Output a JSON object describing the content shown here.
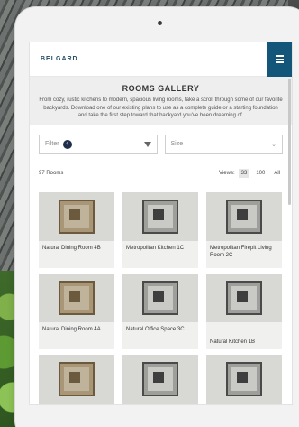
{
  "header": {
    "logo": "BELGARD"
  },
  "gallery": {
    "title": "ROOMS GALLERY",
    "description": "From cozy, rustic kitchens to modern, spacious living rooms, take a scroll through some of our favorite backyards. Download one of our existing plans to use as a complete guide or a starting foundation and take the first step toward that backyard you've been dreaming of."
  },
  "filters": {
    "filter_label": "Filter",
    "filter_count": "4",
    "size_label": "Size"
  },
  "results": {
    "count": "97 Rooms",
    "views_label": "Views:",
    "options": [
      "33",
      "100",
      "All"
    ]
  },
  "rooms": [
    {
      "label": "Natural Dining Room 4B"
    },
    {
      "label": "Metropolitan Kitchen 1C"
    },
    {
      "label": "Metropolitan Firepit Living Room 2C"
    },
    {
      "label": "Natural Dining Room 4A"
    },
    {
      "label": "Natural Office Space 3C"
    },
    {
      "label": "Natural Kitchen 1B"
    },
    {
      "label": ""
    },
    {
      "label": ""
    },
    {
      "label": ""
    }
  ]
}
